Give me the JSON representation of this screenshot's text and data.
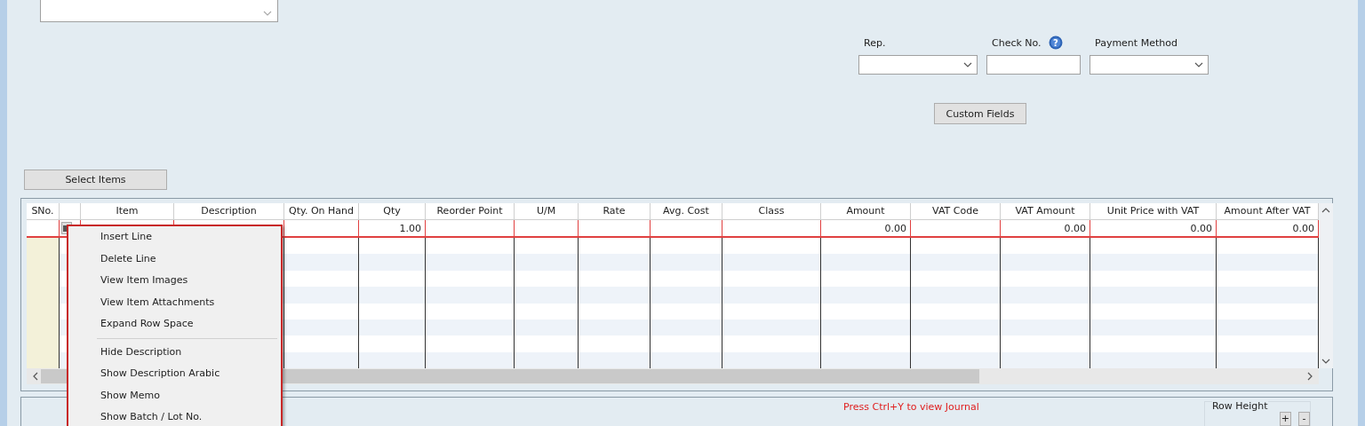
{
  "memo_field": {
    "kind": "dropdown"
  },
  "fields": [
    {
      "label": "Rep.",
      "kind": "combo"
    },
    {
      "label": "Check No.",
      "kind": "text",
      "help_icon": "?"
    },
    {
      "label": "Payment Method",
      "kind": "combo"
    }
  ],
  "custom_fields_button": "Custom Fields",
  "select_items_button": "Select Items",
  "grid": {
    "columns": [
      {
        "label": "SNo.",
        "kind": "text"
      },
      {
        "kind": "handle"
      },
      {
        "label": "Item",
        "kind": "text"
      },
      {
        "label": "Description",
        "kind": "text"
      },
      {
        "label": "Qty. On Hand",
        "kind": "number"
      },
      {
        "label": "Qty",
        "kind": "number"
      },
      {
        "label": "Reorder Point",
        "kind": "number"
      },
      {
        "label": "U/M",
        "kind": "text"
      },
      {
        "label": "Rate",
        "kind": "number"
      },
      {
        "label": "Avg. Cost",
        "kind": "number"
      },
      {
        "label": "Class",
        "kind": "text"
      },
      {
        "label": "Amount",
        "kind": "number"
      },
      {
        "label": "VAT Code",
        "kind": "text"
      },
      {
        "label": "VAT Amount",
        "kind": "number"
      },
      {
        "label": "Unit Price with VAT",
        "kind": "number"
      },
      {
        "label": "Amount After VAT",
        "kind": "number"
      }
    ],
    "rows": [
      {
        "selected": true,
        "cells": [
          {},
          {
            "kind": "row-icon"
          },
          {},
          {},
          {},
          {
            "text": "1.00"
          },
          {},
          {},
          {},
          {},
          {},
          {
            "text": "0.00"
          },
          {},
          {
            "text": "0.00"
          },
          {
            "text": "0.00"
          },
          {
            "text": "0.00"
          }
        ]
      }
    ]
  },
  "context_menu": [
    {
      "kind": "item",
      "label": "Insert Line"
    },
    {
      "kind": "item",
      "label": "Delete Line"
    },
    {
      "kind": "item",
      "label": "View Item Images"
    },
    {
      "kind": "item",
      "label": "View Item Attachments"
    },
    {
      "kind": "item",
      "label": "Expand Row Space"
    },
    {
      "kind": "separator"
    },
    {
      "kind": "item",
      "label": "Hide Description"
    },
    {
      "kind": "item",
      "label": "Show Description Arabic"
    },
    {
      "kind": "item",
      "label": "Show Memo"
    },
    {
      "kind": "item",
      "label": "Show Batch / Lot No."
    }
  ],
  "footer": {
    "journal_hint": "Press Ctrl+Y to view Journal",
    "row_height": {
      "label": "Row Height",
      "buttons": [
        "+",
        "-"
      ]
    }
  }
}
